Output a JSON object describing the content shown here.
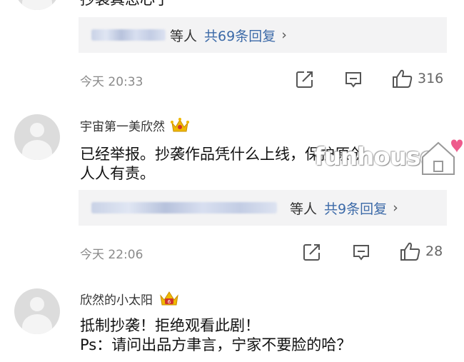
{
  "top_reply": {
    "partial_text": "抄袭真恶心了",
    "reply_box": {
      "blurred_names": "",
      "suffix": "等人",
      "count_label": "共69条回复",
      "chevron": "›"
    },
    "time": "今天 20:33",
    "likes": "316"
  },
  "comments": [
    {
      "username": "宇宙第一美欣然",
      "badge": "crown-icon",
      "lines": [
        "已经举报。抄袭作品凭什么上线，保护原创",
        "人人有责。"
      ],
      "reply_box": {
        "suffix": "等人",
        "count_label": "共9条回复",
        "chevron": "›"
      },
      "time": "今天 22:06",
      "likes": "28"
    },
    {
      "username": "欣然的小太阳",
      "badge": "crown-level-icon",
      "lines": [
        "抵制抄袭！拒绝观看此剧！",
        "Ps：请问出品方聿言，宁家不要脸的哈？"
      ]
    }
  ],
  "watermark": "funhouse",
  "colors": {
    "link": "#3c6aa8",
    "crown": "#e8a900",
    "crown_inner": "#d0342c",
    "heart": "#ee5a8c"
  }
}
